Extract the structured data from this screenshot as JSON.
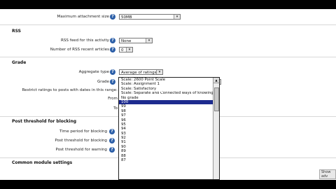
{
  "attachments": {
    "label": "Maximum attachment size",
    "value": "50MB"
  },
  "rss": {
    "heading": "RSS",
    "feed_label": "RSS feed for this activity",
    "feed_value": "None",
    "articles_label": "Number of RSS recent articles",
    "articles_value": "0"
  },
  "grade": {
    "heading": "Grade",
    "aggregate_label": "Aggregate type",
    "aggregate_value": "Average of ratings",
    "grade_label": "Grade",
    "grade_value": "100",
    "restrict_label": "Restrict ratings to posts with dates in this range:",
    "from_label": "From",
    "to_label": "To"
  },
  "dropdown_options": [
    "Scale: 2600 Point Scale",
    "Scale: Assignment 1",
    "Scale: Satisfactory",
    "Scale: Separate and Connected ways of knowing",
    "No grade",
    "100",
    "99",
    "98",
    "97",
    "96",
    "95",
    "94",
    "93",
    "92",
    "91",
    "90",
    "89",
    "88",
    "87"
  ],
  "dropdown_selected_index": 5,
  "post_threshold": {
    "heading": "Post threshold for blocking",
    "time_label": "Time period for blocking",
    "block_label": "Post threshold for blocking",
    "warn_label": "Post threshold for warning"
  },
  "common": {
    "heading": "Common module settings"
  },
  "show_advanced": "Show adv"
}
